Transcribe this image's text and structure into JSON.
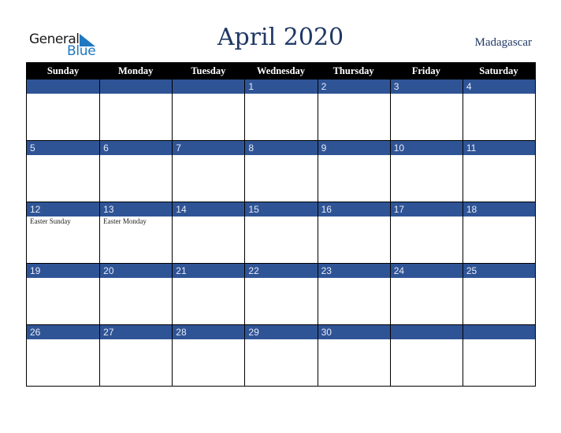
{
  "logo": {
    "word1": "General",
    "word2": "Blue",
    "accent_color": "#1f78c1"
  },
  "header": {
    "title": "April 2020",
    "country": "Madagascar"
  },
  "colors": {
    "header_bg": "#000000",
    "day_strip": "#2f5496",
    "title": "#1f3864"
  },
  "weekdays": [
    "Sunday",
    "Monday",
    "Tuesday",
    "Wednesday",
    "Thursday",
    "Friday",
    "Saturday"
  ],
  "weeks": [
    {
      "days": [
        {
          "num": "",
          "event": ""
        },
        {
          "num": "",
          "event": ""
        },
        {
          "num": "",
          "event": ""
        },
        {
          "num": "1",
          "event": ""
        },
        {
          "num": "2",
          "event": ""
        },
        {
          "num": "3",
          "event": ""
        },
        {
          "num": "4",
          "event": ""
        }
      ]
    },
    {
      "days": [
        {
          "num": "5",
          "event": ""
        },
        {
          "num": "6",
          "event": ""
        },
        {
          "num": "7",
          "event": ""
        },
        {
          "num": "8",
          "event": ""
        },
        {
          "num": "9",
          "event": ""
        },
        {
          "num": "10",
          "event": ""
        },
        {
          "num": "11",
          "event": ""
        }
      ]
    },
    {
      "days": [
        {
          "num": "12",
          "event": "Easter Sunday"
        },
        {
          "num": "13",
          "event": "Easter Monday"
        },
        {
          "num": "14",
          "event": ""
        },
        {
          "num": "15",
          "event": ""
        },
        {
          "num": "16",
          "event": ""
        },
        {
          "num": "17",
          "event": ""
        },
        {
          "num": "18",
          "event": ""
        }
      ]
    },
    {
      "days": [
        {
          "num": "19",
          "event": ""
        },
        {
          "num": "20",
          "event": ""
        },
        {
          "num": "21",
          "event": ""
        },
        {
          "num": "22",
          "event": ""
        },
        {
          "num": "23",
          "event": ""
        },
        {
          "num": "24",
          "event": ""
        },
        {
          "num": "25",
          "event": ""
        }
      ]
    },
    {
      "days": [
        {
          "num": "26",
          "event": ""
        },
        {
          "num": "27",
          "event": ""
        },
        {
          "num": "28",
          "event": ""
        },
        {
          "num": "29",
          "event": ""
        },
        {
          "num": "30",
          "event": ""
        },
        {
          "num": "",
          "event": ""
        },
        {
          "num": "",
          "event": ""
        }
      ]
    }
  ]
}
